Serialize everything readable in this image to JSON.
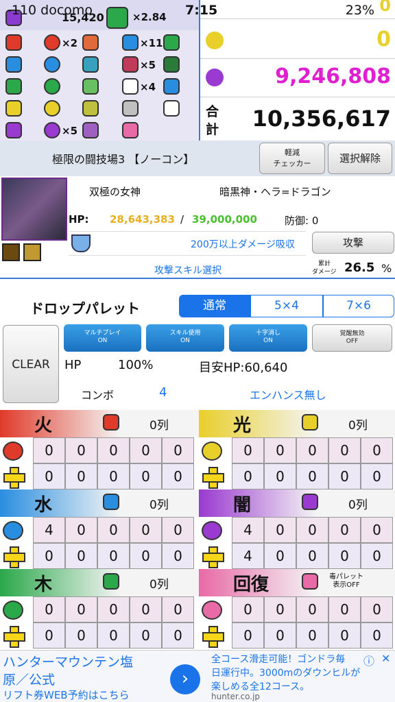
{
  "status": {
    "carrier": "-110 docomo",
    "time": "7:15",
    "battery": "23%"
  },
  "counts": {
    "header_value": "15,420",
    "multiplier": "×2.84",
    "fire_combo": "×2",
    "skill_boost": "×11",
    "bind": "×5",
    "hand": "×4",
    "dark_combo": "×5"
  },
  "totals": {
    "light_value": "0",
    "dark_value": "9,246,808",
    "total_label_1": "合",
    "total_label_2": "計",
    "total_value": "10,356,617",
    "top_value": "0"
  },
  "dungeon": {
    "name": "極限の闘技場3 【ノーコン】",
    "checker_button": "軽減\nチェッカー",
    "deselect_button": "選択解除"
  },
  "monster": {
    "subtitle": "双極の女神",
    "name": "暗黒神・ヘラ=ドラゴン",
    "hp_label": "HP:",
    "hp_current": "28,643,383",
    "hp_sep": "/",
    "hp_max": "39,000,000",
    "defense": "防御: 0",
    "absorb": "200万以上ダメージ吸収",
    "attack_button": "攻撃",
    "skill_select": "攻撃スキル選択",
    "cumulative_label_1": "累計",
    "cumulative_label_2": "ダメージ",
    "cumulative_value": "26.5",
    "cumulative_unit": "%"
  },
  "palette": {
    "title": "ドロップパレット",
    "tabs": [
      "通常",
      "5×4",
      "7×6"
    ],
    "toggles": [
      {
        "label1": "マルチプレイ",
        "label2": "ON"
      },
      {
        "label1": "スキル使用",
        "label2": "ON"
      },
      {
        "label1": "十字消し",
        "label2": "ON"
      },
      {
        "label1": "覚醒無効",
        "label2": "OFF"
      }
    ],
    "clear_button": "CLEAR",
    "hp_label": "HP",
    "hp_percent": "100%",
    "target_hp": "目安HP:60,640",
    "combo_label": "コンボ",
    "combo_value": "4",
    "enhance": "エンハンス無し"
  },
  "boards": [
    {
      "name": "火",
      "cols": "0列",
      "row1": [
        "0",
        "0",
        "0",
        "0",
        "0"
      ],
      "row2": [
        "0",
        "0",
        "0",
        "0",
        "0"
      ],
      "color": "#e03a2a"
    },
    {
      "name": "光",
      "cols": "0列",
      "row1": [
        "0",
        "0",
        "0",
        "0",
        "0"
      ],
      "row2": [
        "0",
        "0",
        "0",
        "0",
        "0"
      ],
      "color": "#e8cf2a"
    },
    {
      "name": "水",
      "cols": "0列",
      "row1": [
        "4",
        "0",
        "0",
        "0",
        "0"
      ],
      "row2": [
        "0",
        "0",
        "0",
        "0",
        "0"
      ],
      "color": "#2a8ee0"
    },
    {
      "name": "闇",
      "cols": "0列",
      "row1": [
        "4",
        "0",
        "0",
        "0",
        "0"
      ],
      "row2": [
        "4",
        "0",
        "0",
        "0",
        "0"
      ],
      "color": "#9a3ad0"
    },
    {
      "name": "木",
      "cols": "0列",
      "row1": [
        "0",
        "0",
        "0",
        "0",
        "0"
      ],
      "row2": [
        "0",
        "0",
        "0",
        "0",
        "0"
      ],
      "color": "#2aa84a"
    },
    {
      "name": "回復",
      "cols": "毒パレット\n表示OFF",
      "row1": [
        "0",
        "0",
        "0",
        "0",
        "0"
      ],
      "row2": [
        "0",
        "0",
        "0",
        "0",
        "0"
      ],
      "color": "#e86aa6"
    }
  ],
  "ad": {
    "line1": "ハンターマウンテン塩",
    "line2": "原／公式",
    "line3": "リフト券WEB予約はこちら",
    "right1": "全コース滑走可能！ゴンドラ毎",
    "right2": "日運行中。3000mのダウンヒルが",
    "right3": "楽しめる全12コース。",
    "url": "hunter.co.jp"
  }
}
